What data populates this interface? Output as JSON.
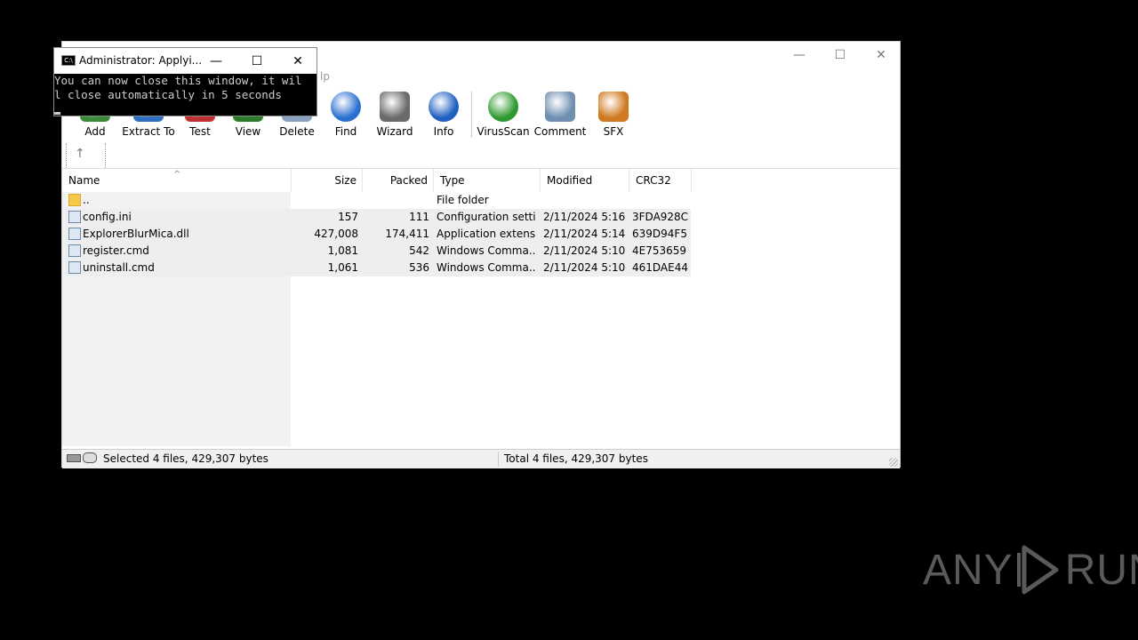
{
  "winrar": {
    "menu_fragment": "lp",
    "window_controls": {
      "minimize": "—",
      "maximize": "☐",
      "close": "✕"
    },
    "toolbar": [
      {
        "label": "Add",
        "icon": "add-icon",
        "color": "#3a8a3a"
      },
      {
        "label": "Extract To",
        "icon": "extract-to-icon",
        "color": "#2f6fc0"
      },
      {
        "label": "Test",
        "icon": "test-icon",
        "color": "#c03030"
      },
      {
        "label": "View",
        "icon": "view-icon",
        "color": "#2a7a2a"
      },
      {
        "label": "Delete",
        "icon": "delete-icon",
        "color": "#8aa0c0"
      },
      {
        "label": "Find",
        "icon": "find-icon",
        "color": "#2a6fd0"
      },
      {
        "label": "Wizard",
        "icon": "wizard-icon",
        "color": "#6a6a6a"
      },
      {
        "label": "Info",
        "icon": "info-icon",
        "color": "#1e5fbf"
      },
      {
        "label": "VirusScan",
        "icon": "virusscan-icon",
        "color": "#2e9a2e"
      },
      {
        "label": "Comment",
        "icon": "comment-icon",
        "color": "#6f8fb0"
      },
      {
        "label": "SFX",
        "icon": "sfx-icon",
        "color": "#d07a20"
      }
    ],
    "columns": [
      "Name",
      "Size",
      "Packed",
      "Type",
      "Modified",
      "CRC32"
    ],
    "rows": [
      {
        "name": "..",
        "size": "",
        "packed": "",
        "type": "File folder",
        "modified": "",
        "crc": "",
        "icon": "folder-icon"
      },
      {
        "name": "config.ini",
        "size": "157",
        "packed": "111",
        "type": "Configuration setti...",
        "modified": "2/11/2024 5:16 ...",
        "crc": "3FDA928C",
        "icon": "ini-file-icon"
      },
      {
        "name": "ExplorerBlurMica.dll",
        "size": "427,008",
        "packed": "174,411",
        "type": "Application extens...",
        "modified": "2/11/2024 5:14 ...",
        "crc": "639D94F5",
        "icon": "dll-file-icon"
      },
      {
        "name": "register.cmd",
        "size": "1,081",
        "packed": "542",
        "type": "Windows Comma...",
        "modified": "2/11/2024 5:10 ...",
        "crc": "4E753659",
        "icon": "cmd-file-icon"
      },
      {
        "name": "uninstall.cmd",
        "size": "1,061",
        "packed": "536",
        "type": "Windows Comma...",
        "modified": "2/11/2024 5:10 ...",
        "crc": "461DAE44",
        "icon": "cmd-file-icon"
      }
    ],
    "status_selected": "Selected 4 files, 429,307 bytes",
    "status_total": "Total 4 files, 429,307 bytes"
  },
  "console": {
    "title": "Administrator:  Applyi...",
    "icon_text": "C:\\",
    "line1": "You can now close this window, it wil",
    "line2": "l close automatically in 5 seconds"
  },
  "watermark": {
    "left": "ANY",
    "right": "RUN"
  }
}
